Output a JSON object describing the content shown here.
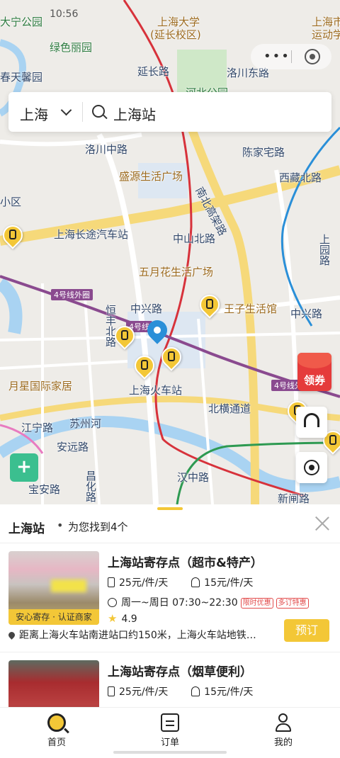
{
  "status": {
    "time": "10:56"
  },
  "colors": {
    "accent": "#f3c737",
    "map_bg": "#eeece8",
    "road_main": "#f6d97a",
    "metro_red": "#d7323b",
    "metro_purple": "#8a4a8f",
    "river": "#a9d3f2",
    "green_btn": "#3bbf8f",
    "coupon": "#e53b3b"
  },
  "search": {
    "city": "上海",
    "query": "上海站"
  },
  "map": {
    "labels": [
      {
        "text": "大宁公园",
        "kind": "green"
      },
      {
        "text": "上海大学",
        "kind": "poi"
      },
      {
        "text": "(延长校区)",
        "kind": "poi"
      },
      {
        "text": "上海市",
        "kind": "poi"
      },
      {
        "text": "运动学",
        "kind": "poi"
      },
      {
        "text": "绿色丽园",
        "kind": "road"
      },
      {
        "text": "延长路",
        "kind": "road"
      },
      {
        "text": "春天馨园",
        "kind": "road"
      },
      {
        "text": "洛川东路",
        "kind": "road"
      },
      {
        "text": "洛川中路",
        "kind": "road"
      },
      {
        "text": "陈家宅路",
        "kind": "road"
      },
      {
        "text": "西藏北路",
        "kind": "road"
      },
      {
        "text": "盛源生活广场",
        "kind": "poi"
      },
      {
        "text": "南北高架路",
        "kind": "road"
      },
      {
        "text": "中山北路",
        "kind": "road"
      },
      {
        "text": "上海长途汽车站",
        "kind": "road"
      },
      {
        "text": "五月花生活广场",
        "kind": "poi"
      },
      {
        "text": "王子生活馆",
        "kind": "poi"
      },
      {
        "text": "中兴路",
        "kind": "road"
      },
      {
        "text": "中兴路",
        "kind": "road"
      },
      {
        "text": "上海火车站",
        "kind": "road"
      },
      {
        "text": "北横通道",
        "kind": "road"
      },
      {
        "text": "月星国际家居",
        "kind": "poi"
      },
      {
        "text": "江宁路",
        "kind": "road"
      },
      {
        "text": "苏州河",
        "kind": "road"
      },
      {
        "text": "安远路",
        "kind": "road"
      },
      {
        "text": "汉中路",
        "kind": "road"
      },
      {
        "text": "新闸路",
        "kind": "road"
      },
      {
        "text": "4号线外圈",
        "kind": "road"
      },
      {
        "text": "4号线",
        "kind": "road"
      },
      {
        "text": "上园路",
        "kind": "road"
      },
      {
        "text": "恒丰北路",
        "kind": "road"
      },
      {
        "text": "宝安路",
        "kind": "road"
      },
      {
        "text": "昌化路",
        "kind": "road"
      },
      {
        "text": "小区",
        "kind": "road"
      },
      {
        "text": "河北公园",
        "kind": "green"
      }
    ],
    "coupon_label": "领券"
  },
  "sheet": {
    "title": "上海站",
    "dot": "•",
    "found": "为您找到4个"
  },
  "stores": [
    {
      "name": "上海站寄存点（超市&特产）",
      "price_small": "25元/件/天",
      "price_large": "15元/件/天",
      "hours": "周一~周日 07:30~22:30",
      "badges": [
        "限时优惠",
        "多订特惠"
      ],
      "rating": "4.9",
      "tag": "安心寄存 · 认证商家",
      "address": "距离上海火车站南进站口约150米，上海火车站地铁…",
      "book": "预订"
    },
    {
      "name": "上海站寄存点（烟草便利）",
      "price_small": "25元/件/天",
      "price_large": "15元/件/天"
    }
  ],
  "tabs": [
    {
      "label": "首页",
      "icon": "search-home-icon"
    },
    {
      "label": "订单",
      "icon": "order-icon"
    },
    {
      "label": "我的",
      "icon": "profile-icon"
    }
  ]
}
